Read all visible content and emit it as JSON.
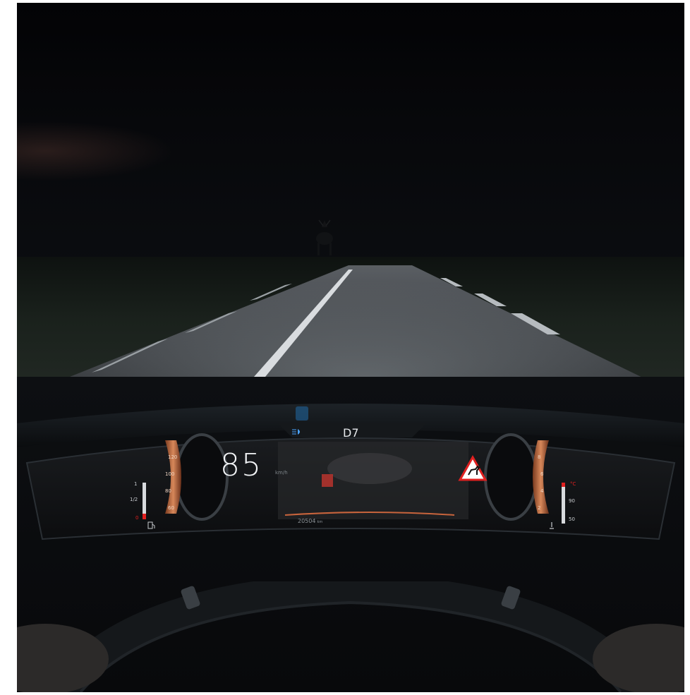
{
  "cluster": {
    "speed": "85",
    "speed_unit": "km/h",
    "gear": "D7",
    "odometer": "20504",
    "odometer_unit": "km",
    "fuel_gauge": {
      "top": "1",
      "middle": "1/2",
      "bottom": "0"
    },
    "temp_gauge": {
      "unit": "°C",
      "upper": "90",
      "lower": "50"
    },
    "tach_left_labels": [
      "120",
      "100",
      "80",
      "60"
    ],
    "tach_right_labels": [
      "8",
      "6",
      "4",
      "2"
    ],
    "warning_icon": "deer-crossing-warning-icon",
    "headlight_icon": "low-beam-icon",
    "accent_color": "#c8643c",
    "warning_color": "#e02020"
  }
}
